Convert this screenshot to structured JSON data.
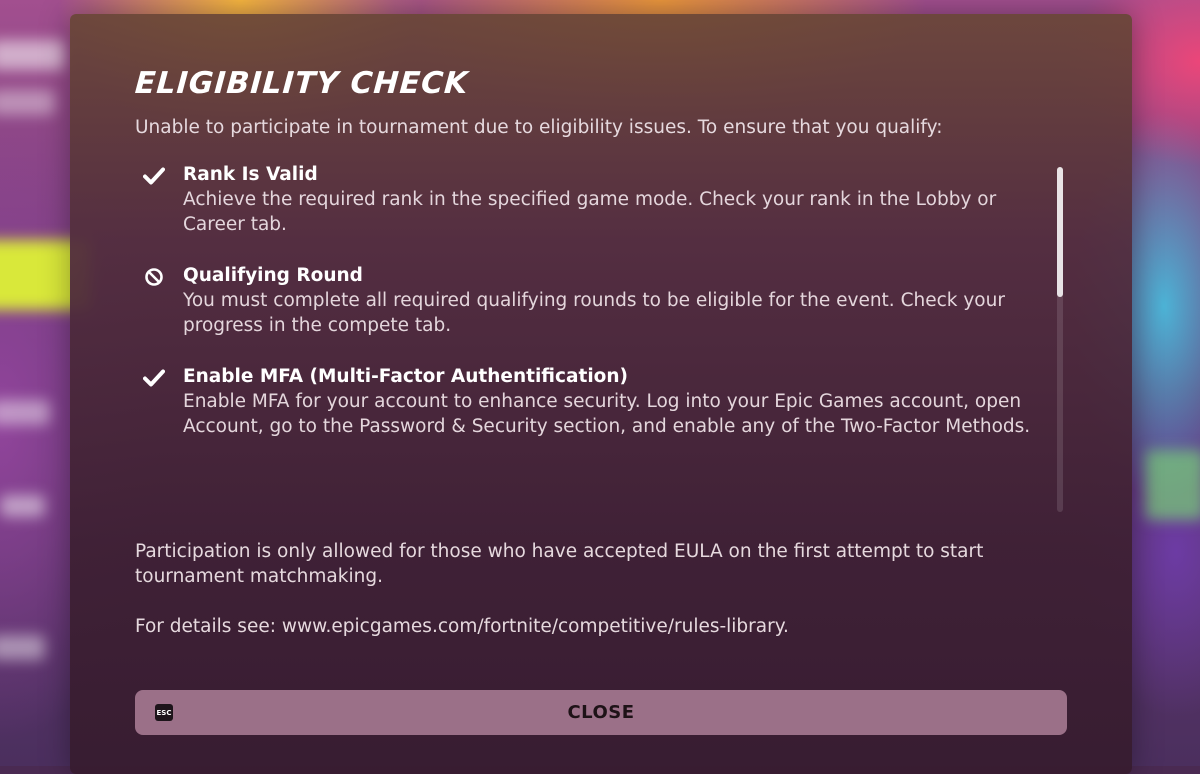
{
  "dialog": {
    "title": "ELIGIBILITY CHECK",
    "intro": "Unable to participate in tournament due to eligibility issues. To ensure that you qualify:",
    "requirements": [
      {
        "title": "Rank Is Valid",
        "status_icon": "checkmark-icon",
        "description": "Achieve the required rank in the specified game mode. Check your rank in the Lobby or Career tab."
      },
      {
        "title": "Qualifying Round",
        "status_icon": "prohibited-icon",
        "description": "You must complete all required qualifying rounds to be eligible for the event. Check your progress in the compete tab."
      },
      {
        "title": "Enable MFA (Multi-Factor Authentification)",
        "status_icon": "checkmark-icon",
        "description": "Enable MFA for your account to enhance security. Log into your Epic Games account, open Account, go to the Password & Security section, and enable any of the Two-Factor Methods."
      }
    ],
    "eula_note": "Participation is only allowed for those who have accepted EULA on the first attempt to start tournament matchmaking.",
    "details_note": "For details see: www.epicgames.com/fortnite/competitive/rules-library.",
    "close_button": {
      "key_hint": "ESC",
      "label": "CLOSE"
    }
  },
  "colors": {
    "button_bg": "#9b7088",
    "text_primary": "#ffffff",
    "text_secondary": "#e4d6dc"
  }
}
